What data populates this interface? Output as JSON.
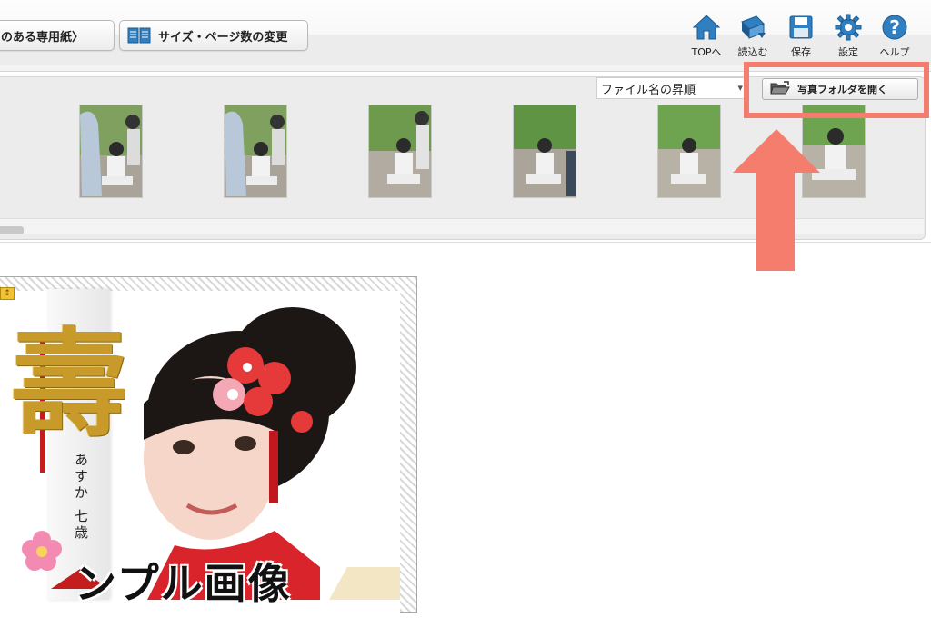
{
  "toolbar": {
    "special_paper_label": "のある専用紙〉",
    "size_change_label": "サイズ・ページ数の変更",
    "nav": [
      {
        "label": "TOPへ",
        "icon": "home-icon"
      },
      {
        "label": "読込む",
        "icon": "load-book-icon"
      },
      {
        "label": "保存",
        "icon": "save-floppy-icon"
      },
      {
        "label": "設定",
        "icon": "gear-icon"
      },
      {
        "label": "ヘルプ",
        "icon": "help-icon"
      }
    ]
  },
  "photo_strip": {
    "sort": {
      "selected": "ファイル名の昇順",
      "icon": "chevron-down-icon"
    },
    "open_folder_label": "写真フォルダを開く",
    "open_folder_icon": "folder-open-icon",
    "thumbnails": [
      "photo-1",
      "photo-2",
      "photo-3",
      "photo-4",
      "photo-5",
      "photo-6"
    ]
  },
  "annotation": {
    "color": "#f47d6d",
    "arrow_icon": "up-arrow-icon"
  },
  "canvas": {
    "banner_kanji": "壽",
    "banner_name": "あすか 七歳",
    "sample_text": "ンプル画像",
    "corner_marker": "↕"
  },
  "colors": {
    "toolbar_icon_blue": "#2f7fc1",
    "highlight": "#f47d6d",
    "gold": "#c79a2a",
    "kimono_red": "#d8242a"
  }
}
